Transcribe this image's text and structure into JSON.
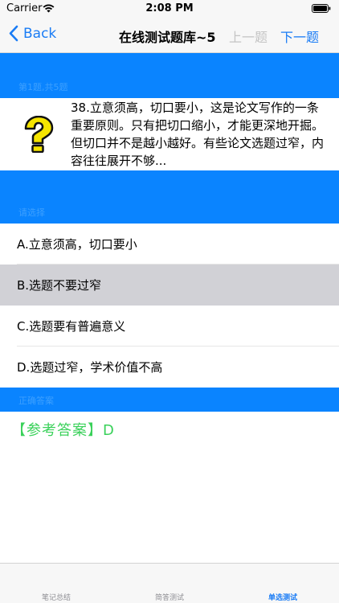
{
  "status": {
    "carrier": "Carrier",
    "time": "2:08 PM"
  },
  "nav": {
    "back_label": "Back",
    "title": "在线测试题库~5",
    "prev_label": "上一题",
    "next_label": "下一题"
  },
  "question": {
    "progress_label": "第1题,共5题",
    "text": "38.立意须高，切口要小，这是论文写作的一条重要原则。只有把切口缩小，才能更深地开掘。但切口并不是越小越好。有些论文选题过窄，内容往往展开不够..."
  },
  "options_header": "请选择",
  "options": [
    {
      "label": "A.立意须高，切口要小"
    },
    {
      "label": "B.选题不要过窄"
    },
    {
      "label": "C.选题要有普遍意义"
    },
    {
      "label": "D.选题过窄，学术价值不高"
    }
  ],
  "answer_header": "正确答案",
  "answer_text": "【参考答案】D",
  "tabs": [
    {
      "label": "笔记总结"
    },
    {
      "label": "简答测试"
    },
    {
      "label": "单选测试"
    }
  ],
  "colors": {
    "accent": "#1a7cf5",
    "header_bar": "#0a84ff",
    "answer": "#3ad15a",
    "selected": "#d1d1d6"
  }
}
